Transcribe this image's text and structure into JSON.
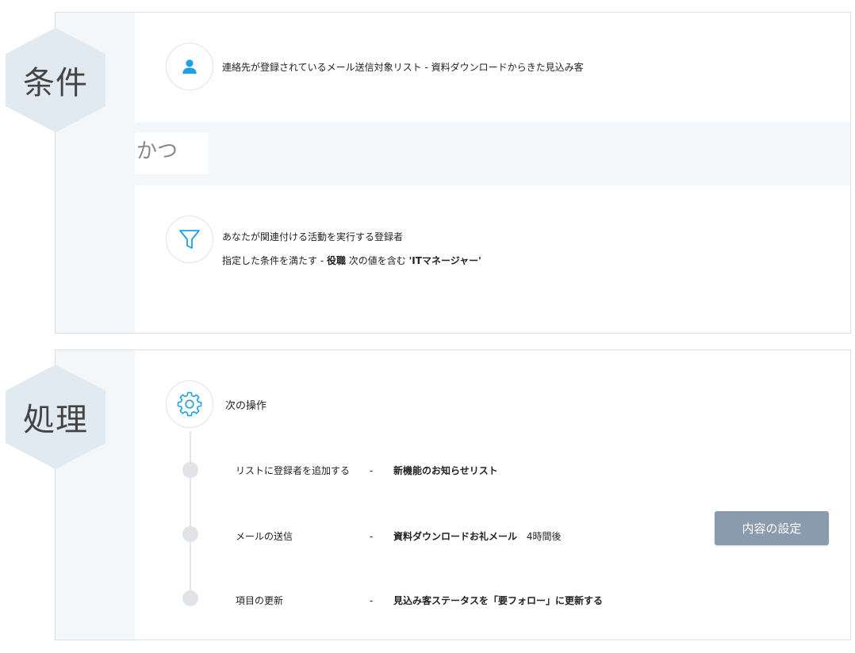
{
  "conditions": {
    "label": "条件",
    "item1": {
      "text": "連絡先が登録されているメール送信対象リスト - 資料ダウンロードからきた見込み客"
    },
    "and_label": "かつ",
    "item2": {
      "line1": "あなたが関連付ける活動を実行する登録者",
      "line2_prefix": "指定した条件を満たす - ",
      "line2_field": "役職",
      "line2_op": " 次の値を含む ",
      "line2_value": "'ITマネージャー'"
    }
  },
  "processing": {
    "label": "処理",
    "header": "次の操作",
    "steps": [
      {
        "action": "リストに登録者を追加する",
        "sep": "-",
        "value": "新機能のお知らせリスト",
        "extra": ""
      },
      {
        "action": "メールの送信",
        "sep": "-",
        "value": "資料ダウンロードお礼メール",
        "extra": "4時間後"
      },
      {
        "action": "項目の更新",
        "sep": "-",
        "value": "見込み客ステータスを「要フォロー」に更新する",
        "extra": ""
      }
    ],
    "settings_button": "内容の設定"
  },
  "colors": {
    "accent": "#1ea0e6",
    "button": "#8b9bae",
    "hex": "#e1eaf0",
    "rail": "#f4f7f9"
  },
  "icons": {
    "person": "user-icon",
    "filter": "filter-icon",
    "gear": "gear-icon"
  }
}
